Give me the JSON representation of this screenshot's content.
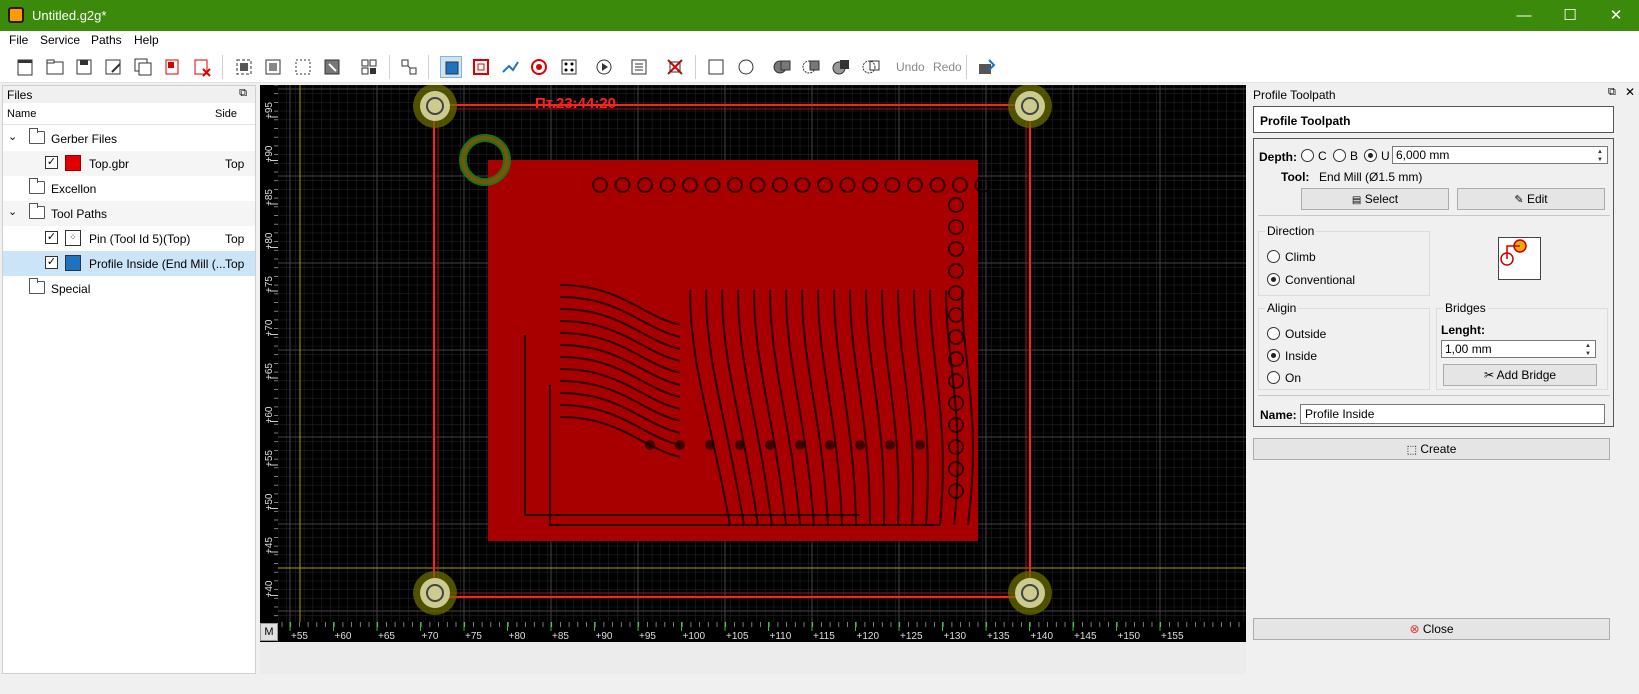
{
  "window": {
    "title": "Untitled.g2g*",
    "minimize": "—",
    "maximize": "☐",
    "close": "✕"
  },
  "menu": [
    "File",
    "Service",
    "Paths",
    "Help"
  ],
  "toolbar": {
    "undo": "Undo",
    "redo": "Redo"
  },
  "files_panel": {
    "title": "Files",
    "col_name": "Name",
    "col_side": "Side",
    "rows": [
      {
        "label": "Gerber Files",
        "side": ""
      },
      {
        "label": "Top.gbr",
        "side": "Top"
      },
      {
        "label": "Excellon",
        "side": ""
      },
      {
        "label": "Tool Paths",
        "side": ""
      },
      {
        "label": "Pin (Tool Id 5)(Top)",
        "side": "Top"
      },
      {
        "label": "Profile Inside (End Mill (...",
        "side": "Top"
      },
      {
        "label": "Special",
        "side": ""
      }
    ]
  },
  "canvas": {
    "overlay_text": "Пт.23:44:20",
    "x_ticks": [
      "+55",
      "+60",
      "+65",
      "+70",
      "+75",
      "+80",
      "+85",
      "+90",
      "+95",
      "+100",
      "+105",
      "+110",
      "+115",
      "+120",
      "+125",
      "+130",
      "+135",
      "+140",
      "+145",
      "+150",
      "+155"
    ],
    "y_ticks": [
      "+95",
      "+90",
      "+85",
      "+80",
      "+75",
      "+70",
      "+65",
      "+60",
      "+55",
      "+50",
      "+45",
      "+40"
    ],
    "corner_button": "M",
    "colors": {
      "background": "#000000",
      "copper": "#c00000",
      "outline": "#ff2020",
      "grid": "#333333",
      "drill": "#e8e000"
    }
  },
  "profile_panel": {
    "dock_title": "Profile Toolpath",
    "heading": "Profile Toolpath",
    "depth_label": "Depth:",
    "depth_options": [
      "C",
      "B",
      "U"
    ],
    "depth_value": "6,000 mm",
    "tool_label": "Tool:",
    "tool_value": "End Mill (Ø1.5 mm)",
    "select_button": "Select",
    "edit_button": "Edit",
    "direction": {
      "title": "Direction",
      "options": [
        "Climb",
        "Conventional"
      ],
      "selected": "Conventional"
    },
    "align": {
      "title": "Aligin",
      "options": [
        "Outside",
        "Inside",
        "On"
      ],
      "selected": "Inside"
    },
    "bridges": {
      "title": "Bridges",
      "length_label": "Lenght:",
      "length_value": "1,00 mm",
      "add_button": "Add Bridge"
    },
    "name_label": "Name:",
    "name_value": "Profile Inside",
    "create_button": "Create",
    "close_button": "Close"
  }
}
